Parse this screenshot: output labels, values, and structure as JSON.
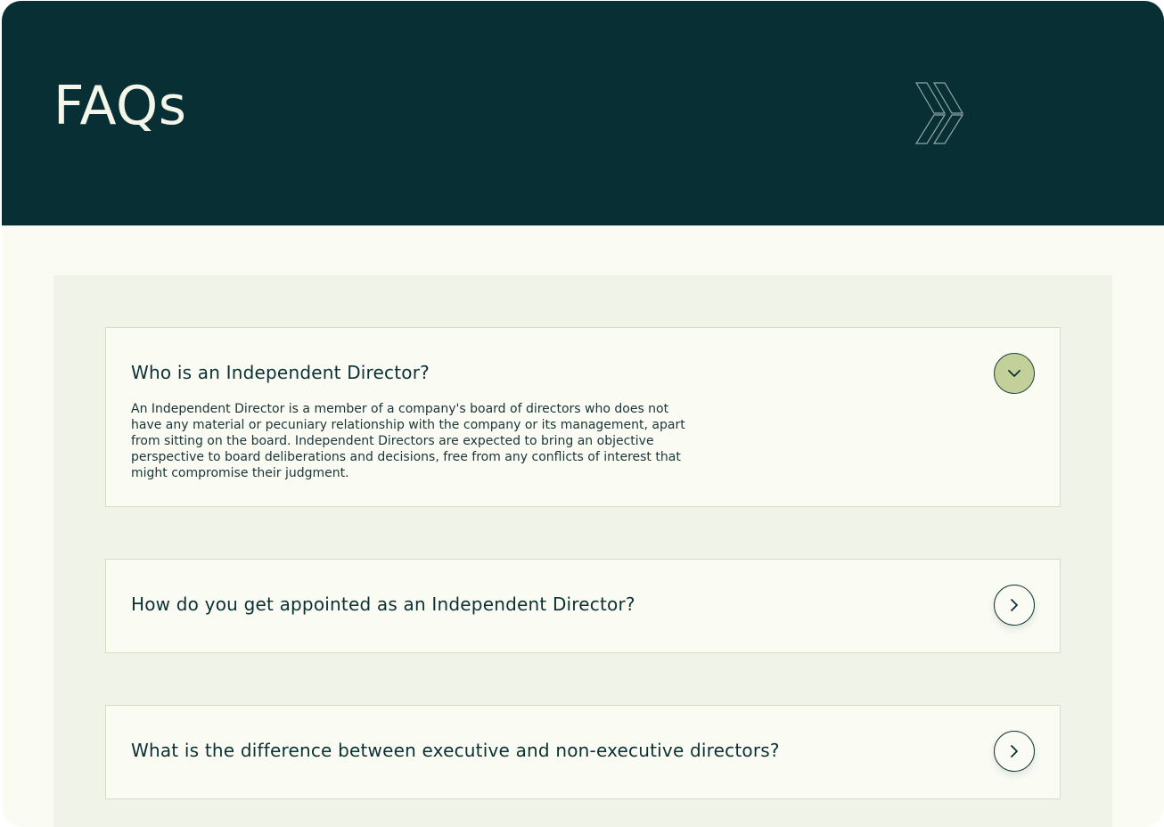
{
  "header": {
    "title": "FAQs",
    "decor_icon": "double-chevron-right-icon"
  },
  "colors": {
    "header_bg": "#082f34",
    "page_bg": "#fafcf4",
    "panel_bg": "#f0f4e8",
    "accent": "#c3d09a",
    "text": "#0b3033"
  },
  "faqs": [
    {
      "question": "Who is an Independent Director?",
      "answer": "An Independent Director is a member of a company's board of directors who does not have any material or pecuniary relationship with the company or its management, apart from sitting on the board. Independent Directors are expected to bring an objective perspective to board deliberations and decisions, free from any conflicts of interest that might compromise their judgment.",
      "expanded": true,
      "toggle_icon": "chevron-down-icon"
    },
    {
      "question": "How do you get appointed as an Independent Director?",
      "expanded": false,
      "toggle_icon": "chevron-right-icon"
    },
    {
      "question": "What is the difference between executive and non-executive directors?",
      "expanded": false,
      "toggle_icon": "chevron-right-icon"
    }
  ]
}
